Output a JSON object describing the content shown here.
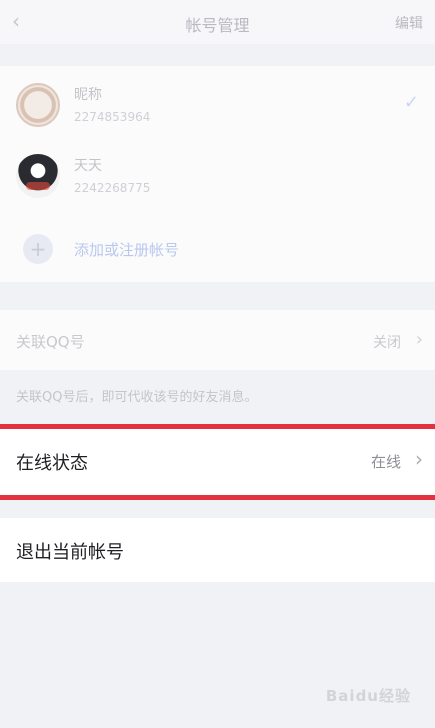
{
  "nav": {
    "back_glyph": "‹",
    "title": "帐号管理",
    "edit_label": "编辑"
  },
  "accounts": [
    {
      "name": "昵称",
      "qq": "2274853964",
      "active": true
    },
    {
      "name": "天天",
      "qq": "2242268775",
      "active": false
    }
  ],
  "add_account": {
    "icon": "+",
    "label": "添加或注册帐号"
  },
  "linked_qq": {
    "label": "关联QQ号",
    "value": "关闭"
  },
  "hint": "关联QQ号后，即可代收该号的好友消息。",
  "online_status": {
    "label": "在线状态",
    "value": "在线"
  },
  "logout": {
    "label": "退出当前帐号"
  },
  "watermark": "Baidu经验",
  "colors": {
    "highlight": "#e4313f",
    "accent": "#bac8ee",
    "background": "#f1f2f6"
  }
}
